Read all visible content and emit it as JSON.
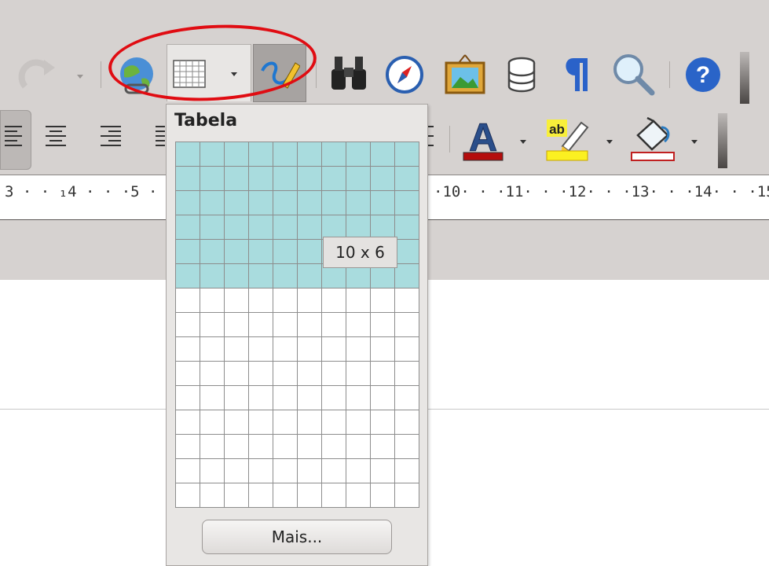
{
  "toolbar": {
    "insert_table_tooltip": "Tabela",
    "font_color_icon": "A",
    "highlight_icon": "ab",
    "help_icon": "?"
  },
  "ruler": {
    "left_ticks": "3 · · ₁4 · · ·5 ·",
    "right_ticks": "·10· · ·11· · ·12· · ·13· · ·14· · ·15"
  },
  "table_popup": {
    "title": "Tabela",
    "columns": 10,
    "rows": 15,
    "selected_columns": 10,
    "selected_rows": 6,
    "size_label": "10 x 6",
    "more_button_label": "Mais..."
  },
  "colors": {
    "selected_cell": "#a9dcde",
    "annotation_ellipse": "#e00c12"
  }
}
